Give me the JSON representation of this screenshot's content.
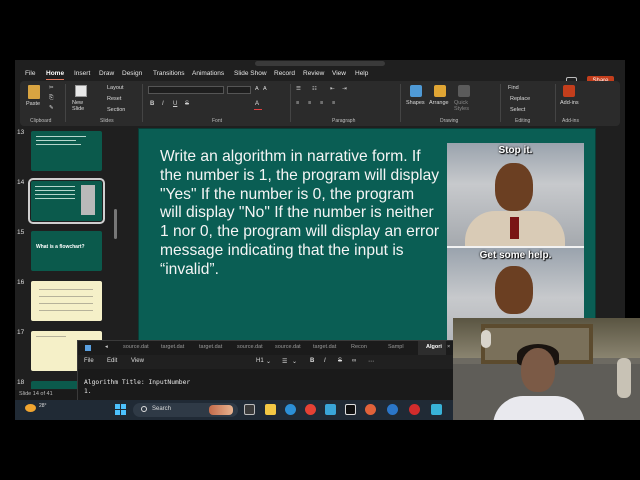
{
  "menu": {
    "items": [
      "File",
      "Home",
      "Insert",
      "Draw",
      "Design",
      "Transitions",
      "Animations",
      "Slide Show",
      "Record",
      "Review",
      "View",
      "Help"
    ],
    "active": "Home",
    "share_label": "Share"
  },
  "ribbon": {
    "clipboard": {
      "paste": "Paste",
      "label": "Clipboard"
    },
    "slides": {
      "new_slide": "New Slide",
      "layout": "Layout",
      "reset": "Reset",
      "section": "Section",
      "label": "Slides"
    },
    "font": {
      "bold": "B",
      "italic": "I",
      "underline": "U",
      "strike": "S",
      "label": "Font"
    },
    "paragraph": {
      "label": "Paragraph"
    },
    "drawing": {
      "shapes": "Shapes",
      "arrange": "Arrange",
      "quick_styles": "Quick Styles",
      "label": "Drawing"
    },
    "editing": {
      "find": "Find",
      "replace": "Replace",
      "select": "Select",
      "label": "Editing"
    },
    "addins": {
      "addins": "Add-ins",
      "label": "Add-ins"
    }
  },
  "thumbnails": [
    {
      "num": "13",
      "title": ""
    },
    {
      "num": "14",
      "title": ""
    },
    {
      "num": "15",
      "title": "What is a flowchart?"
    },
    {
      "num": "16",
      "title": ""
    },
    {
      "num": "17",
      "title": ""
    },
    {
      "num": "18",
      "title": ""
    }
  ],
  "slide": {
    "text": "Write an algorithm in narrative form. If the number is 1, the program will display \"Yes\" If the number is 0, the program will display \"No\" If the number is neither 1 nor 0, the program will display an error message indicating that the input is “invalid”.",
    "meme_top": "Stop it.",
    "meme_bottom": "Get some help."
  },
  "status": {
    "slide_info": "Slide 14 of 41"
  },
  "editor": {
    "tabs": [
      "source.dat",
      "target.dat",
      "target.dat",
      "source.dat",
      "source.dat",
      "target.dat",
      "Recon",
      "Sampl",
      "Algori"
    ],
    "active_tab": "Algori",
    "menu": [
      "File",
      "Edit",
      "View"
    ],
    "heading_select": "H1",
    "lines": [
      "Algorithm Title: InputNumber",
      "1."
    ]
  },
  "taskbar": {
    "search_label": "Search",
    "weather": "28°"
  },
  "colors": {
    "slide_bg": "#0a5e54",
    "accent": "#c43e1c",
    "taskbar": "#202a35"
  }
}
